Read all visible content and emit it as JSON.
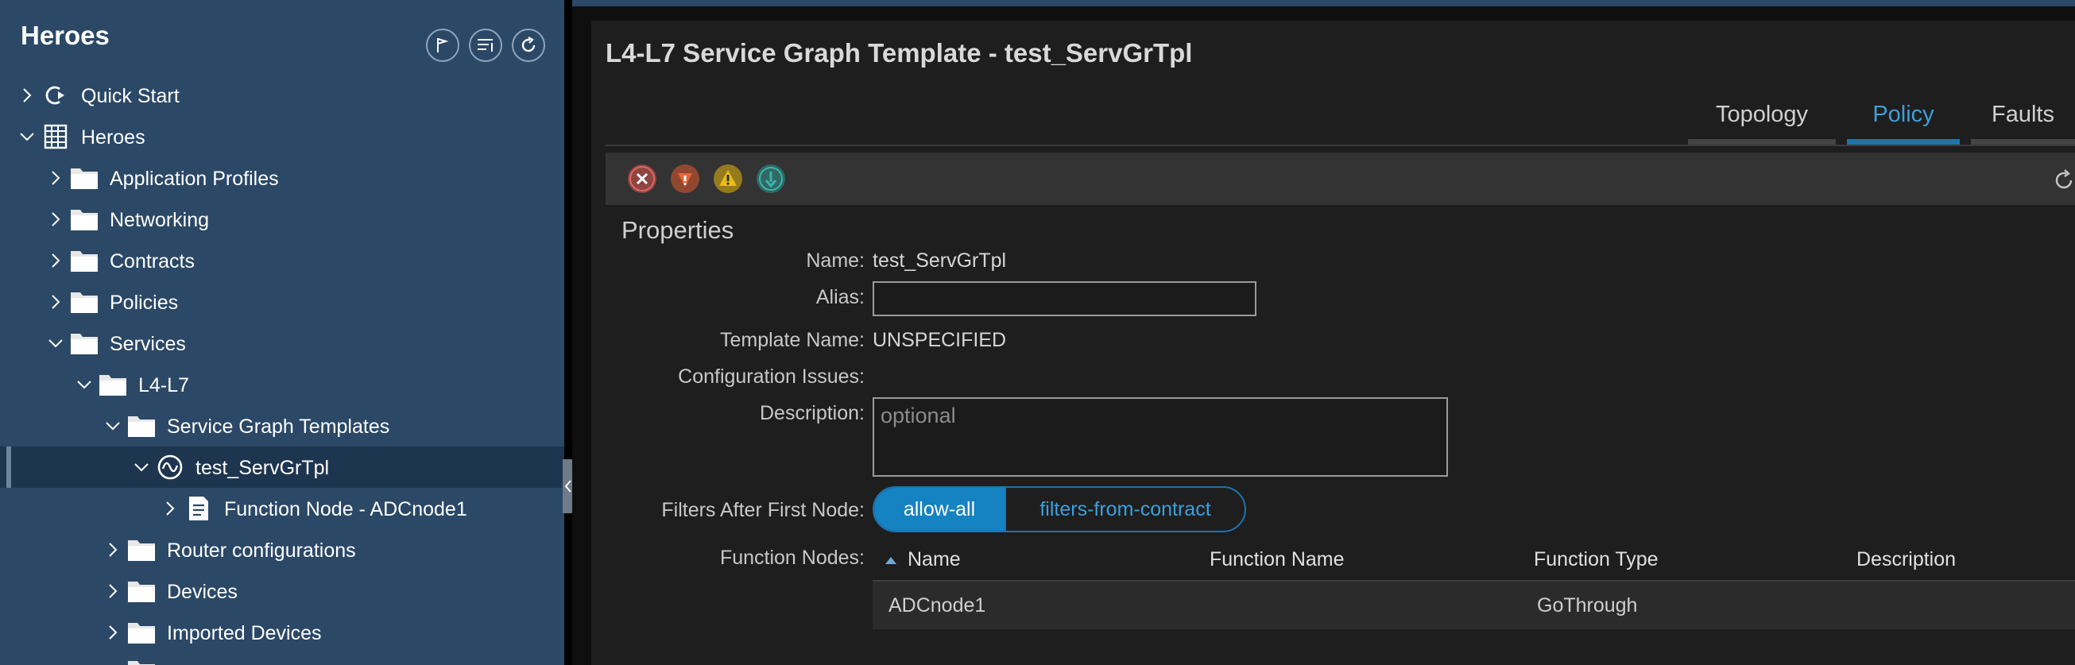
{
  "sidebar": {
    "title": "Heroes",
    "tree": [
      {
        "label": "Quick Start",
        "icon": "quick-start-icon",
        "expanded": false
      },
      {
        "label": "Heroes",
        "icon": "building-icon",
        "expanded": true
      },
      {
        "label": "Application Profiles",
        "icon": "folder-icon",
        "expanded": false
      },
      {
        "label": "Networking",
        "icon": "folder-icon",
        "expanded": false
      },
      {
        "label": "Contracts",
        "icon": "folder-icon",
        "expanded": false
      },
      {
        "label": "Policies",
        "icon": "folder-icon",
        "expanded": false
      },
      {
        "label": "Services",
        "icon": "folder-icon",
        "expanded": true
      },
      {
        "label": "L4-L7",
        "icon": "folder-icon",
        "expanded": true
      },
      {
        "label": "Service Graph Templates",
        "icon": "folder-icon",
        "expanded": true
      },
      {
        "label": "test_ServGrTpl",
        "icon": "service-graph-icon",
        "expanded": true,
        "selected": true
      },
      {
        "label": "Function Node - ADCnode1",
        "icon": "document-icon",
        "expanded": false
      },
      {
        "label": "Router configurations",
        "icon": "folder-icon",
        "expanded": false
      },
      {
        "label": "Devices",
        "icon": "folder-icon",
        "expanded": false
      },
      {
        "label": "Imported Devices",
        "icon": "folder-icon",
        "expanded": false
      }
    ]
  },
  "page": {
    "title": "L4-L7 Service Graph Template - test_ServGrTpl",
    "tabs": [
      {
        "label": "Topology",
        "active": false
      },
      {
        "label": "Policy",
        "active": true
      },
      {
        "label": "Faults",
        "active": false
      }
    ]
  },
  "faults": {
    "critical_color": "#d9534f",
    "major_color": "#e05a2b",
    "minor_color": "#e5b70c",
    "warning_color": "#2fa8a0"
  },
  "properties": {
    "section_title": "Properties",
    "name_label": "Name:",
    "name_value": "test_ServGrTpl",
    "alias_label": "Alias:",
    "alias_value": "",
    "template_name_label": "Template Name:",
    "template_name_value": "UNSPECIFIED",
    "config_issues_label": "Configuration Issues:",
    "config_issues_value": "",
    "description_label": "Description:",
    "description_placeholder": "optional",
    "filters_label": "Filters After First Node:",
    "filters_options": [
      "allow-all",
      "filters-from-contract"
    ],
    "filters_selected": "allow-all",
    "function_nodes_label": "Function Nodes:"
  },
  "function_nodes_table": {
    "columns": [
      "Name",
      "Function Name",
      "Function Type",
      "Description"
    ],
    "sort_column": "Name",
    "rows": [
      {
        "name": "ADCnode1",
        "function_name": "",
        "function_type": "GoThrough",
        "description": ""
      }
    ]
  },
  "colors": {
    "sidebar_bg": "#2b4866",
    "accent": "#1582c2"
  }
}
